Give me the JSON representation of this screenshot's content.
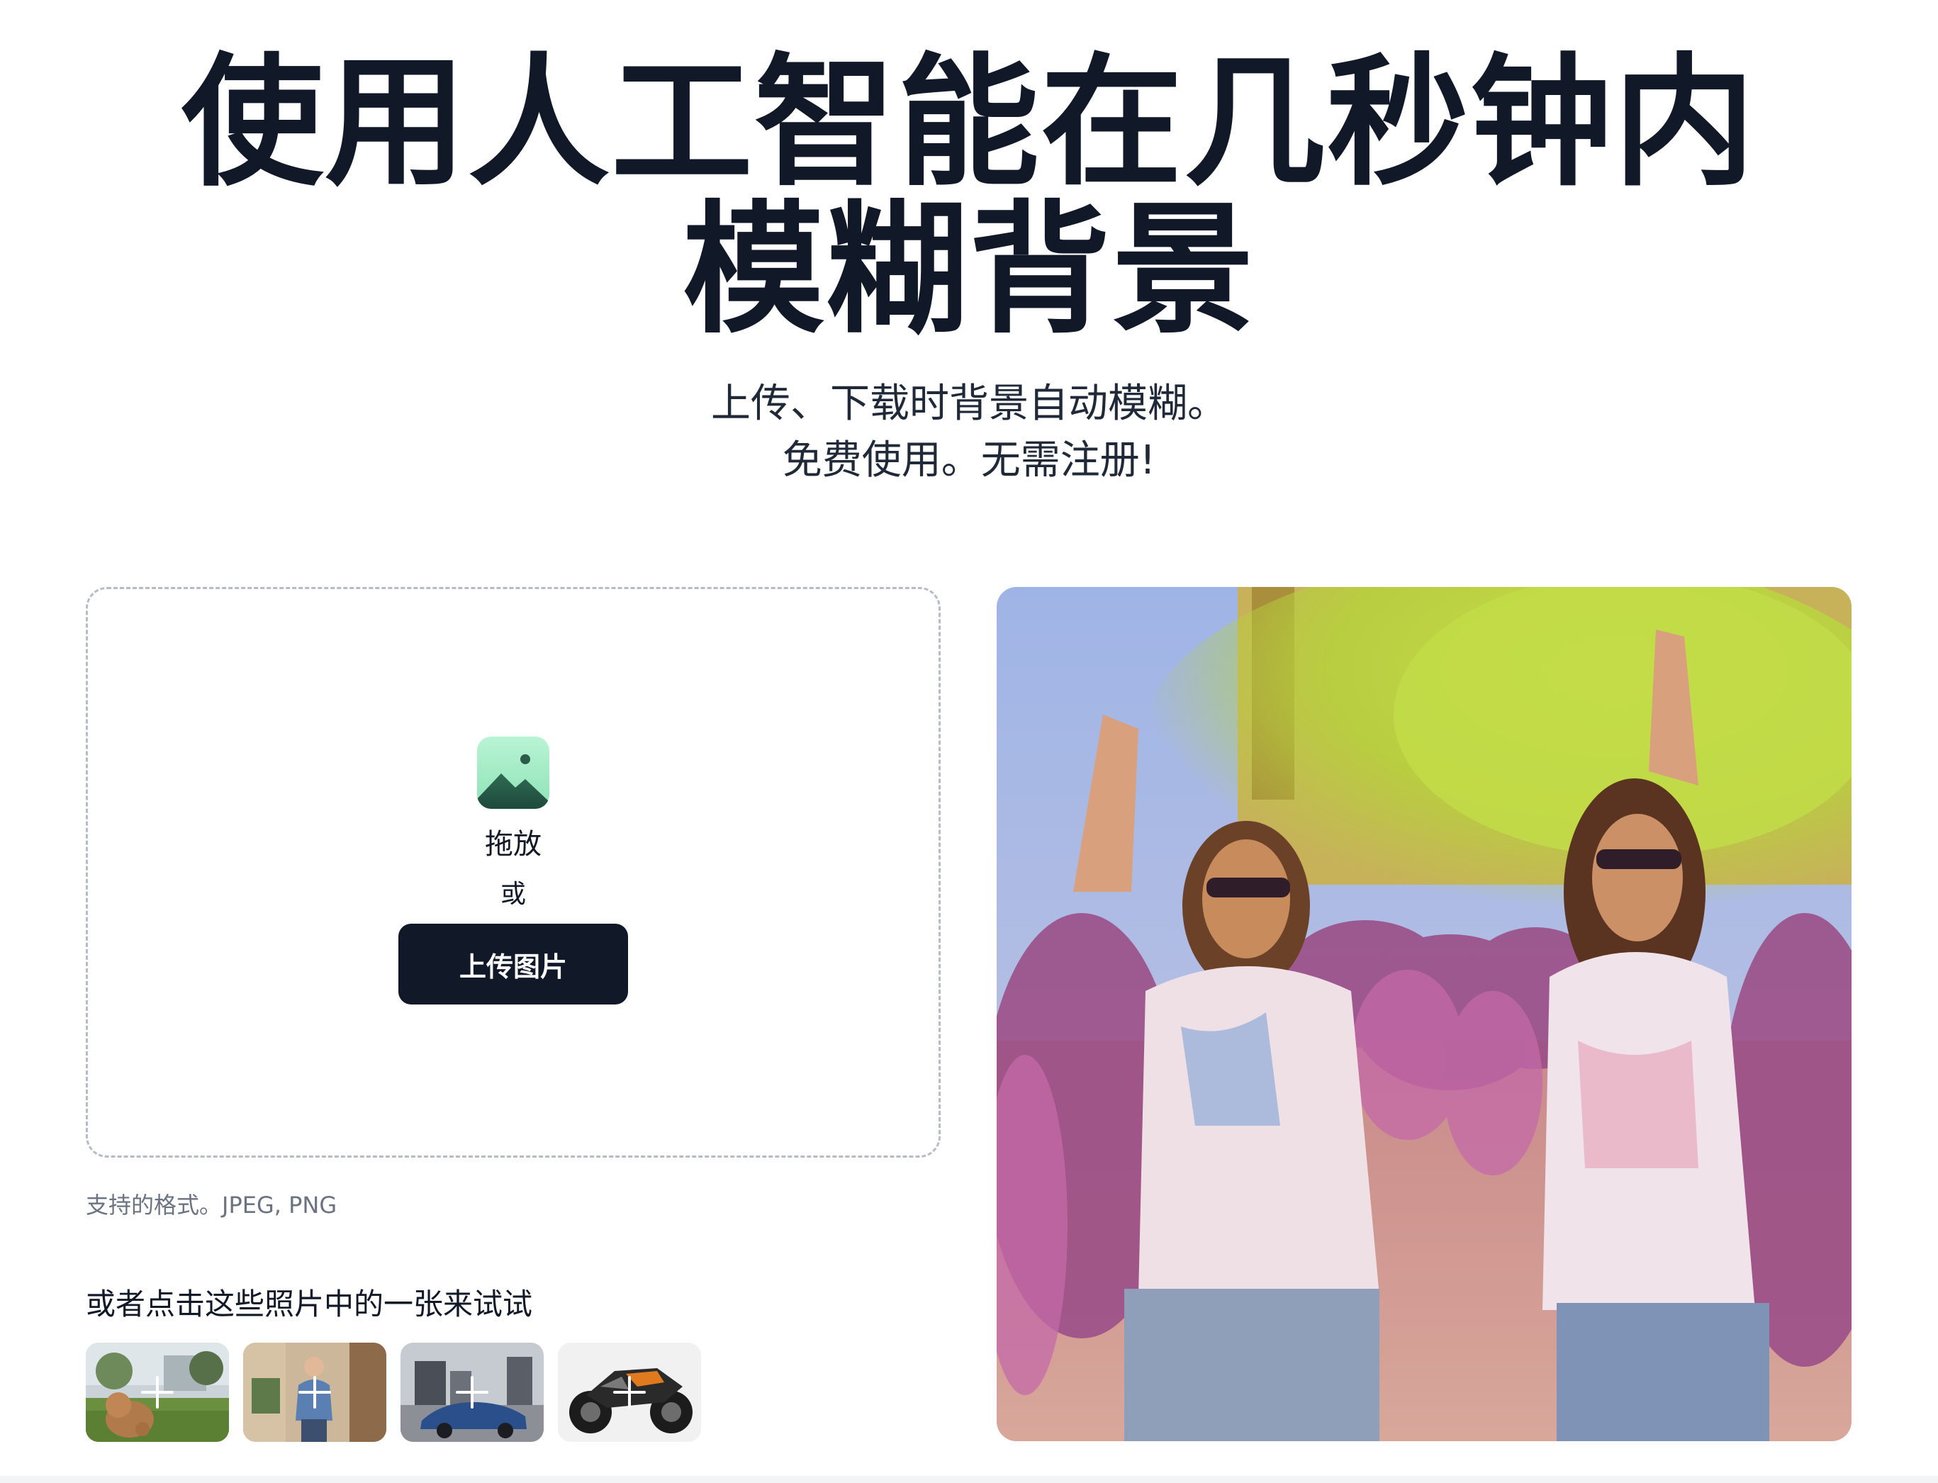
{
  "hero": {
    "title": "使用人工智能在几秒钟内模糊背景",
    "subtitle_line1": "上传、下载时背景自动模糊。",
    "subtitle_line2": "免费使用。无需注册!"
  },
  "dropzone": {
    "icon": "image-icon",
    "drag_label": "拖放",
    "or_label": "或",
    "upload_button_label": "上传图片"
  },
  "formats_text": "支持的格式。JPEG, PNG",
  "samples": {
    "label": "或者点击这些照片中的一张来试试",
    "items": [
      {
        "icon": "dog-photo-thumbnail"
      },
      {
        "icon": "woman-photo-thumbnail"
      },
      {
        "icon": "car-photo-thumbnail"
      },
      {
        "icon": "motorcycle-photo-thumbnail"
      }
    ]
  },
  "preview": {
    "icon": "festival-photo"
  },
  "colors": {
    "primary_dark": "#111827",
    "muted_text": "#6b7280",
    "dashed_border": "#b6bcc6",
    "icon_green": "#8de2b7"
  }
}
